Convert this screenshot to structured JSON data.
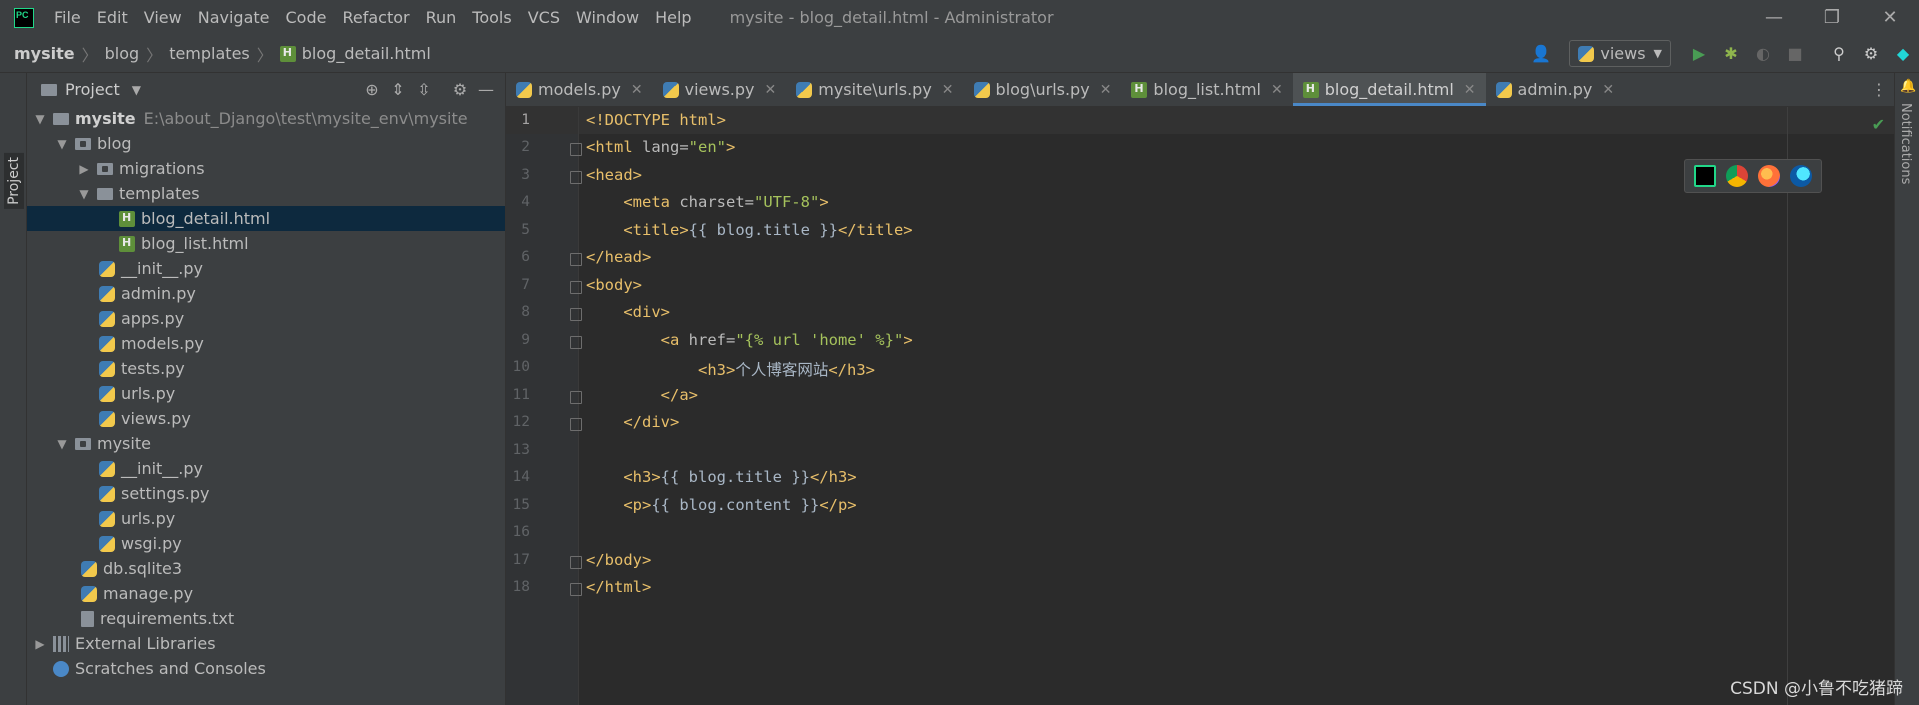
{
  "window": {
    "title": "mysite - blog_detail.html - Administrator",
    "menu": [
      "File",
      "Edit",
      "View",
      "Navigate",
      "Code",
      "Refactor",
      "Run",
      "Tools",
      "VCS",
      "Window",
      "Help"
    ],
    "controls": {
      "minimize": "—",
      "restore": "❐",
      "close": "✕"
    }
  },
  "breadcrumb": [
    "mysite",
    "blog",
    "templates",
    "blog_detail.html"
  ],
  "toolbar": {
    "run_config": "views",
    "icons": [
      "user-icon",
      "run-icon",
      "debug-icon",
      "coverage-icon",
      "stop-icon",
      "search-icon",
      "settings-icon",
      "toolbox-icon"
    ]
  },
  "left_stripe": {
    "project_label": "Project"
  },
  "right_stripe": {
    "notifications_label": "Notifications"
  },
  "project_panel": {
    "title": "Project",
    "root": {
      "name": "mysite",
      "path": "E:\\about_Django\\test\\mysite_env\\mysite"
    },
    "tree": {
      "blog": "blog",
      "migrations": "migrations",
      "templates": "templates",
      "blog_detail": "blog_detail.html",
      "blog_list": "blog_list.html",
      "blog_init": "__init__.py",
      "admin": "admin.py",
      "apps": "apps.py",
      "models": "models.py",
      "tests": "tests.py",
      "blog_urls": "urls.py",
      "views": "views.py",
      "mysite_pkg": "mysite",
      "mysite_init": "__init__.py",
      "settings": "settings.py",
      "mysite_urls": "urls.py",
      "wsgi": "wsgi.py",
      "db": "db.sqlite3",
      "manage": "manage.py",
      "requirements": "requirements.txt",
      "external": "External Libraries",
      "scratches": "Scratches and Consoles"
    }
  },
  "tabs": [
    {
      "label": "models.py",
      "type": "py"
    },
    {
      "label": "views.py",
      "type": "py"
    },
    {
      "label": "mysite\\urls.py",
      "type": "py"
    },
    {
      "label": "blog\\urls.py",
      "type": "py"
    },
    {
      "label": "blog_list.html",
      "type": "html"
    },
    {
      "label": "blog_detail.html",
      "type": "html",
      "active": true
    },
    {
      "label": "admin.py",
      "type": "py"
    }
  ],
  "editor": {
    "line_numbers": [
      "1",
      "2",
      "3",
      "4",
      "5",
      "6",
      "7",
      "8",
      "9",
      "10",
      "11",
      "12",
      "13",
      "14",
      "15",
      "16",
      "17",
      "18"
    ],
    "lines": {
      "l1": "<!DOCTYPE html>",
      "l2a": "<html ",
      "l2b": "lang=",
      "l2c": "\"en\"",
      "l2d": ">",
      "l3": "<head>",
      "l4a": "    <meta ",
      "l4b": "charset=",
      "l4c": "\"UTF-8\"",
      "l4d": ">",
      "l5a": "    <title>",
      "l5b": "{{ blog.title }}",
      "l5c": "</title>",
      "l6": "</head>",
      "l7": "<body>",
      "l8": "    <div>",
      "l9a": "        <a ",
      "l9b": "href=",
      "l9c": "\"{% url 'home' %}\"",
      "l9d": ">",
      "l10a": "            <h3>",
      "l10b": "个人博客网站",
      "l10c": "</h3>",
      "l11": "        </a>",
      "l12": "    </div>",
      "l14a": "    <h3>",
      "l14b": "{{ blog.title }}",
      "l14c": "</h3>",
      "l15a": "    <p>",
      "l15b": "{{ blog.content }}",
      "l15c": "</p>",
      "l17": "</body>",
      "l18": "</html>"
    }
  },
  "watermark": "CSDN @小鲁不吃猪蹄"
}
